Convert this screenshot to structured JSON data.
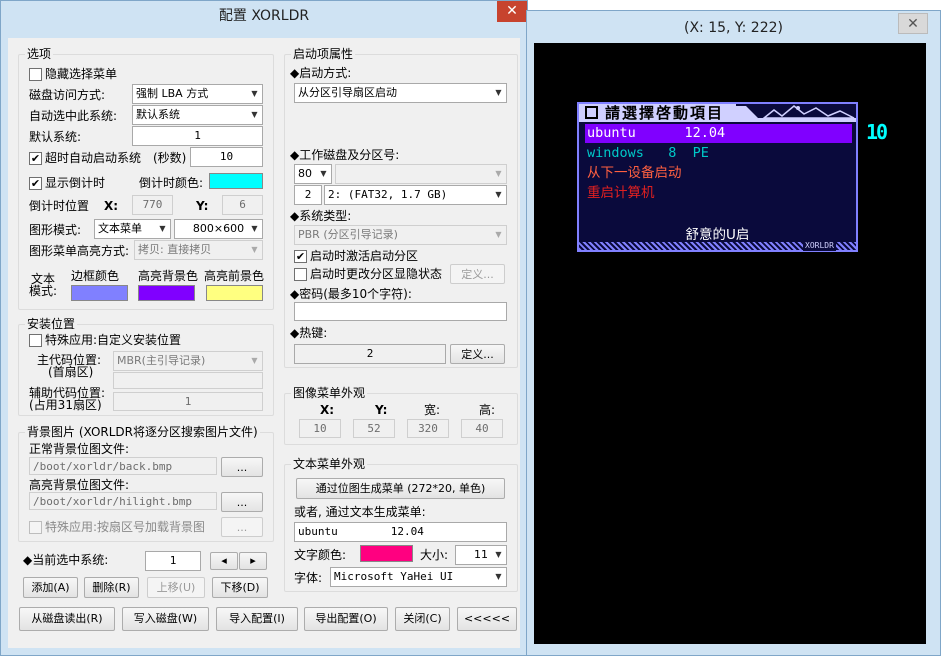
{
  "left_window": {
    "title": "配置 XORLDR",
    "close": "✕"
  },
  "options": {
    "title": "选项",
    "hide_menu": "隐藏选择菜单",
    "disk_access_label": "磁盘访问方式:",
    "disk_access_value": "强制 LBA 方式",
    "auto_select_label": "自动选中此系统:",
    "auto_select_value": "默认系统",
    "default_sys_label": "默认系统:",
    "default_sys_value": "1",
    "timeout_label": "超时自动启动系统",
    "timeout_unit": "(秒数)",
    "timeout_value": "10",
    "show_countdown": "显示倒计时",
    "countdown_color_label": "倒计时颜色:",
    "countdown_color": "#00ffff",
    "countdown_pos_label": "倒计时位置",
    "x_label": "X:",
    "x_value": "770",
    "y_label": "Y:",
    "y_value": "6",
    "graphic_mode_label": "图形模式:",
    "graphic_mode_value": "文本菜单",
    "resolution_value": "800×600",
    "highlight_mode_label": "图形菜单高亮方式:",
    "highlight_mode_value": "拷贝: 直接拷贝",
    "text_mode_label_1": "文本",
    "text_mode_label_2": "模式:",
    "border_color_label": "边框颜色",
    "border_color": "#8080ff",
    "hl_bg_label": "高亮背景色",
    "hl_bg_color": "#8000ff",
    "hl_fg_label": "高亮前景色",
    "hl_fg_color": "#ffff80"
  },
  "install": {
    "title": "安装位置",
    "special": "特殊应用:自定义安装位置",
    "main_code_label_1": "主代码位置:",
    "main_code_label_2": "(首扇区)",
    "main_code_value": "MBR(主引导记录)",
    "aux_code_label_1": "辅助代码位置:",
    "aux_code_label_2": "(占用31扇区)",
    "aux_code_value": "1"
  },
  "background": {
    "title": "背景图片 (XORLDR将逐分区搜索图片文件)",
    "normal_label": "正常背景位图文件:",
    "normal_path": "/boot/xorldr/back.bmp",
    "highlight_label": "高亮背景位图文件:",
    "highlight_path": "/boot/xorldr/hilight.bmp",
    "browse": "...",
    "special": "特殊应用:按扇区号加载背景图"
  },
  "current": {
    "label": "◆当前选中系统:",
    "value": "1",
    "prev": "◂",
    "next": "▸"
  },
  "buttons": {
    "add": "添加(A)",
    "delete": "删除(R)",
    "up": "上移(U)",
    "down": "下移(D)",
    "read_disk": "从磁盘读出(R)",
    "write_disk": "写入磁盘(W)",
    "import": "导入配置(I)",
    "export": "导出配置(O)",
    "close": "关闭(C)",
    "collapse": "<<<<<"
  },
  "boot_props": {
    "title": "启动项属性",
    "method_label": "◆启动方式:",
    "method_value": "从分区引导扇区启动",
    "disk_label": "◆工作磁盘及分区号:",
    "disk_value": "80",
    "part_num": "2",
    "part_value": "2: (FAT32,    1.7 GB)",
    "systype_label": "◆系统类型:",
    "systype_value": "PBR (分区引导记录)",
    "activate": "启动时激活启动分区",
    "hide_change": "启动时更改分区显隐状态",
    "define": "定义...",
    "password_label": "◆密码(最多10个字符):",
    "password_value": "",
    "hotkey_label": "◆热键:",
    "hotkey_value": "2"
  },
  "image_menu": {
    "title": "图像菜单外观",
    "x_label": "X:",
    "y_label": "Y:",
    "w_label": "宽:",
    "h_label": "高:",
    "x": "10",
    "y": "52",
    "w": "320",
    "h": "40"
  },
  "text_menu": {
    "title": "文本菜单外观",
    "gen_button": "通过位图生成菜单 (272*20, 单色)",
    "or_label": "或者, 通过文本生成菜单:",
    "text_value": "ubuntu        12.04",
    "color_label": "文字颜色:",
    "color": "#ff0080",
    "size_label": "大小:",
    "size_value": "11",
    "font_label": "字体:",
    "font_value": "Microsoft YaHei UI"
  },
  "preview_window": {
    "title": "(X: 15, Y: 222)",
    "close": "✕",
    "menu_title": "請選擇啓動項目",
    "countdown": "10",
    "brand": "XORLDR",
    "items": [
      {
        "text": "ubuntu      12.04",
        "color": "#ffffff"
      },
      {
        "text": "windows   8  PE",
        "color": "#00c8c8"
      },
      {
        "text": "从下一设备启动",
        "color": "#ff6040"
      },
      {
        "text": "重启计算机",
        "color": "#e02020"
      }
    ],
    "footer": "舒意的U启"
  }
}
